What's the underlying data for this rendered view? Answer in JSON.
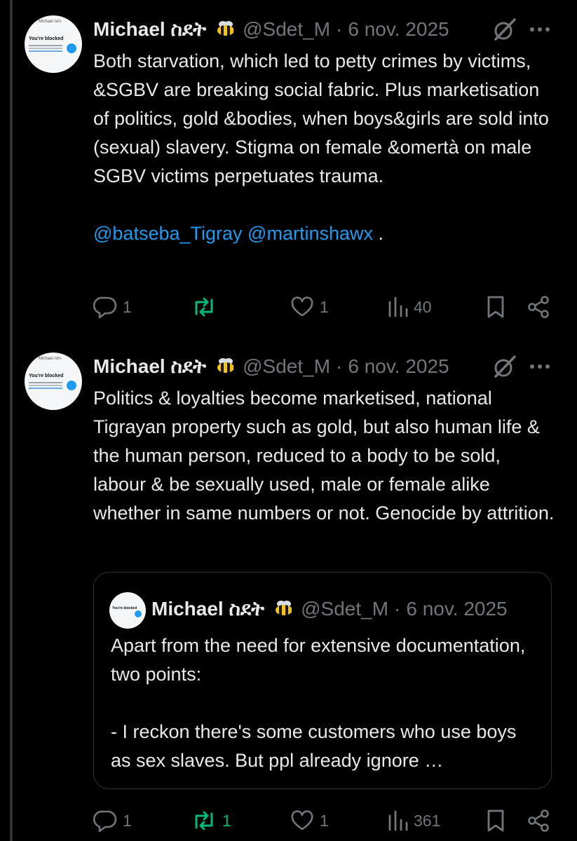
{
  "colors": {
    "background": "#000000",
    "text": "#e7e9ea",
    "muted": "#71767b",
    "link": "#1d9bf0",
    "repost": "#00ba7c",
    "border": "#2f3336"
  },
  "avatar": {
    "top_line": "Michael ስደት",
    "title": "You're blocked"
  },
  "tweets": [
    {
      "author": "Michael ስደት",
      "handle": "@Sdet_M",
      "separator": "·",
      "date": "6 nov. 2025",
      "text": "Both starvation, which led to petty crimes by victims, &SGBV are breaking social fabric. Plus marketisation of politics, gold &bodies, when boys&girls are sold into (sexual) slavery. Stigma on female &omertà on male SGBV victims perpetuates trauma.",
      "mention_1": "@batseba_Tigray",
      "mention_2": "@martinshawx",
      "mention_suffix": " .",
      "replies": "1",
      "reposts": "",
      "likes": "1",
      "views": "40"
    },
    {
      "author": "Michael ስደት",
      "handle": "@Sdet_M",
      "separator": "·",
      "date": "6 nov. 2025",
      "text": "Politics & loyalties become marketised, national Tigrayan property such as gold, but also human life & the human person, reduced to a body to be sold, labour & be sexually used, male or female alike whether in same numbers or not. Genocide by attrition.",
      "replies": "1",
      "reposts": "1",
      "likes": "1",
      "views": "361",
      "quote": {
        "author": "Michael ስደት",
        "handle": "@Sdet_M",
        "separator": "·",
        "date": "6 nov. 2025",
        "paragraph_1": "Apart from the need for extensive documentation, two points:",
        "paragraph_2": "- I reckon there's some customers who use boys as sex slaves. But ppl already ignore …"
      }
    }
  ],
  "icons": [
    "grok-icon",
    "more-icon",
    "reply-icon",
    "repost-icon",
    "like-icon",
    "views-icon",
    "bookmark-icon",
    "share-icon",
    "bee-emoji-icon"
  ]
}
